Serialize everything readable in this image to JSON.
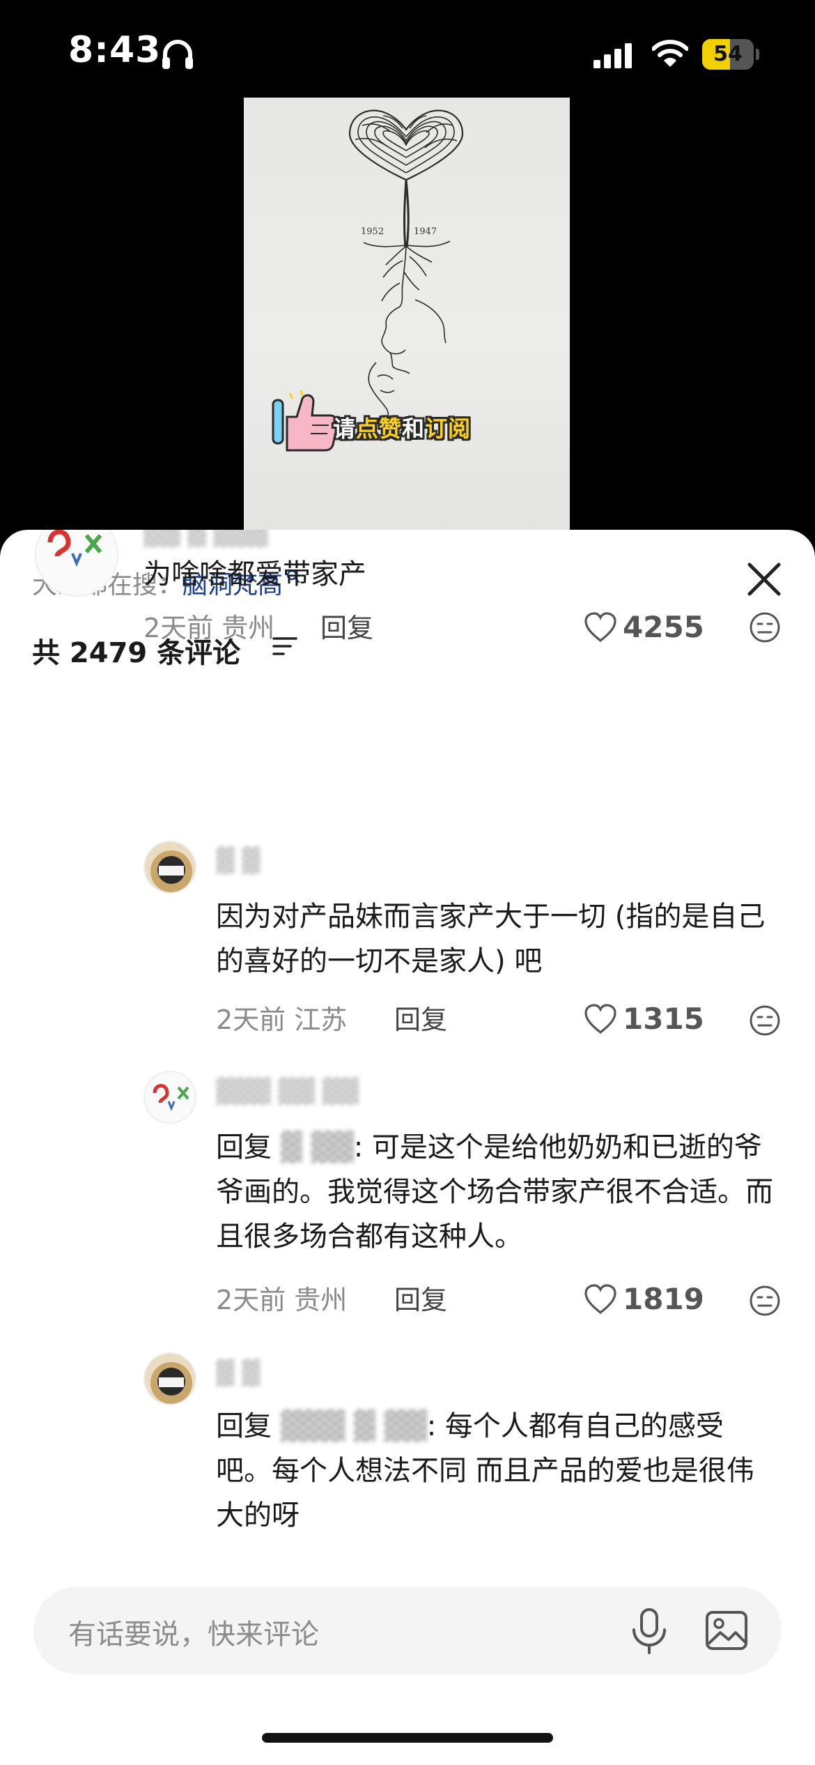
{
  "status_bar": {
    "time": "8:43",
    "battery": "54",
    "battery_level": 0.54
  },
  "video": {
    "sticker_prefix": "请",
    "sticker_mid1": "点赞",
    "sticker_mid2": "和",
    "sticker_end": "订阅",
    "years_left": "1952",
    "years_right": "1947"
  },
  "search": {
    "label": "大家都在搜：",
    "term": "脑洞梵高"
  },
  "comments_header": {
    "count_text": "共 2479 条评论"
  },
  "comments": [
    {
      "text": "为啥啥都爱带家产",
      "time": "2天前",
      "location": "贵州",
      "reply": "回复",
      "likes": "4255"
    },
    {
      "text": "因为对产品妹而言家产大于一切 (指的是自己的喜好的一切不是家人) 吧",
      "time": "2天前",
      "location": "江苏",
      "reply": "回复",
      "likes": "1315"
    },
    {
      "reply_prefix": "回复",
      "text": ": 可是这个是给他奶奶和已逝的爷爷画的。我觉得这个场合带家产很不合适。而且很多场合都有这种人。",
      "time": "2天前",
      "location": "贵州",
      "reply": "回复",
      "likes": "1819"
    },
    {
      "reply_prefix": "回复",
      "text": ": 每个人都有自己的感受吧。每个人想法不同 而且产品的爱也是很伟大的呀"
    }
  ],
  "input": {
    "placeholder": "有话要说，快来评论"
  }
}
